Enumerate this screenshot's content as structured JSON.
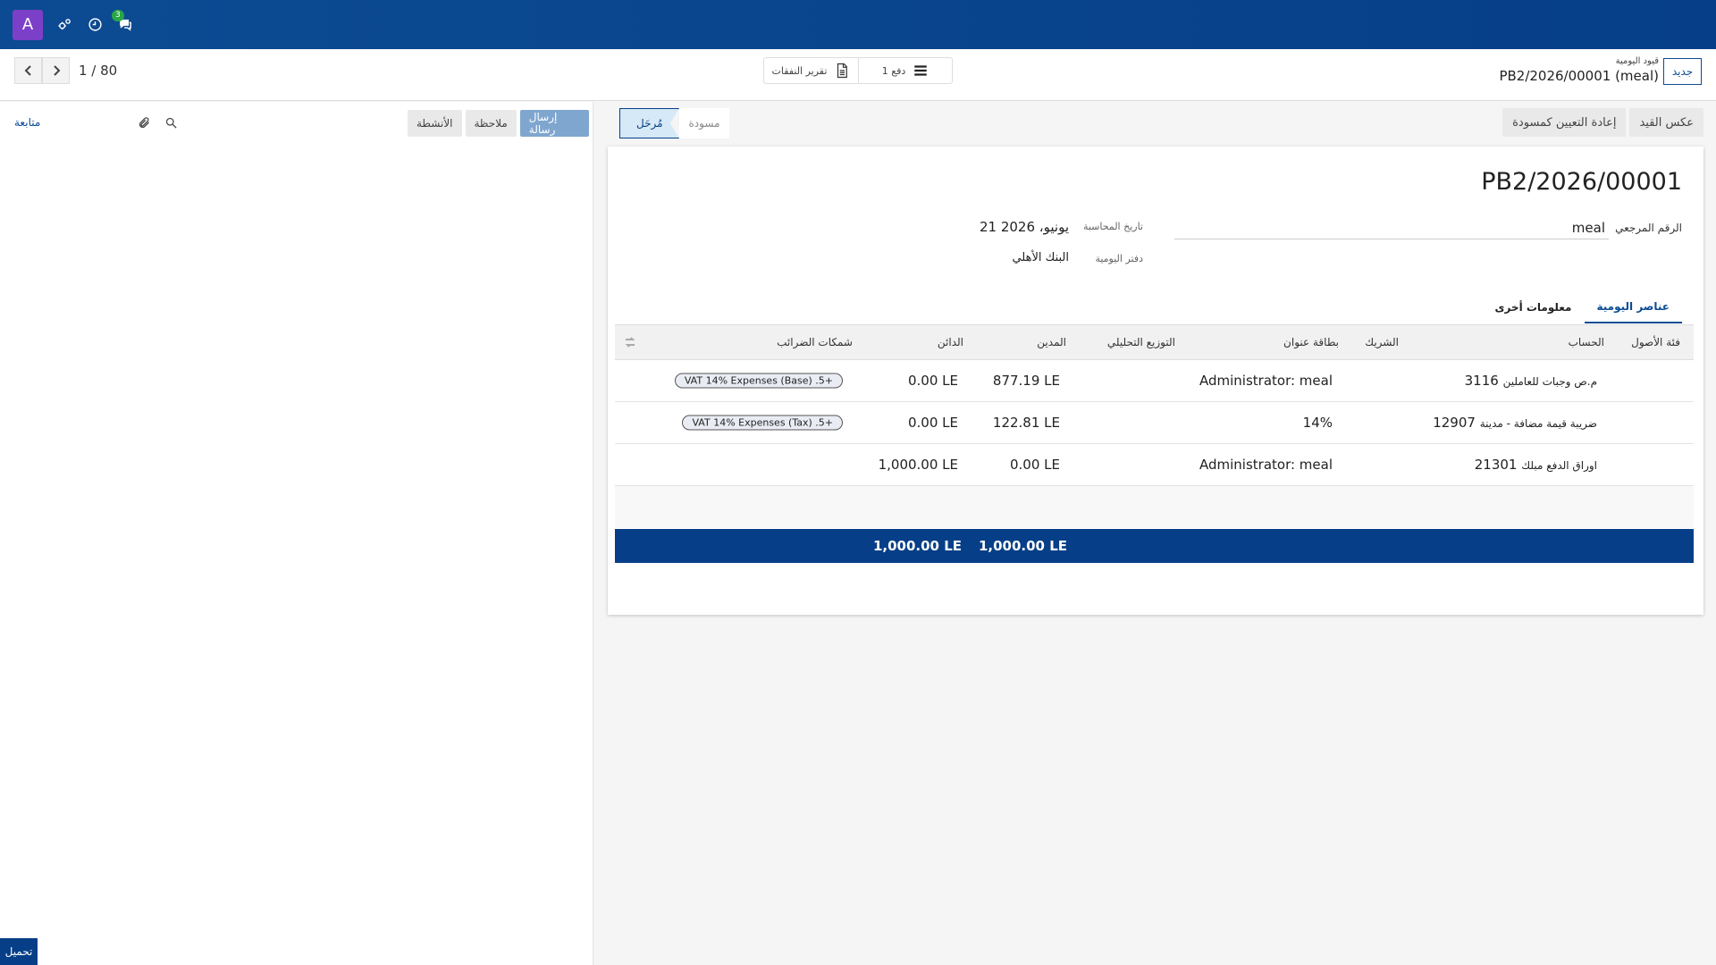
{
  "navbar": {
    "avatar_letter": "A",
    "messages_badge": "3"
  },
  "pager": {
    "value": "1 / 80"
  },
  "center_box": {
    "report_label": "تقرير النفقات",
    "payment_label": "دفع 1"
  },
  "breadcrumb": {
    "parent": "قيود اليومية",
    "title": "PB2/2026/00001 (meal)",
    "new_label": "جديد"
  },
  "chatter": {
    "follow_label": "متابعة",
    "send_message": "إرسال رسالة",
    "log_note": "ملاحظة",
    "activities": "الأنشطة",
    "upload": "تحميل"
  },
  "status": {
    "posted": "مُرحَل",
    "draft": "مسودة"
  },
  "actions": {
    "reset_draft": "إعادة التعيين كمسودة",
    "reverse": "عكس القيد"
  },
  "form": {
    "title": "PB2/2026/00001",
    "ref_label": "الرقم المرجعي",
    "ref_value": "meal",
    "date_label": "تاريخ المحاسبة",
    "date_value": "21 يونيو، 2026",
    "journal_label": "دفتر اليومية",
    "journal_value": "البنك الأهلي"
  },
  "tabs": [
    {
      "label": "عناصر اليومية",
      "active": true
    },
    {
      "label": "معلومات أخرى",
      "active": false
    }
  ],
  "table": {
    "headers": {
      "asset_category": "فئة الأصول",
      "account": "الحساب",
      "partner": "الشريك",
      "label": "بطاقة عنوان",
      "analytic": "التوزيع التحليلي",
      "debit": "المدين",
      "credit": "الدائن",
      "taxes": "شمكات الضرائب"
    },
    "rows": [
      {
        "account_code": "3116",
        "account_name": "م.ص وجبات للعاملين",
        "label": "Administrator: meal",
        "debit": "877.19 LE",
        "credit": "0.00 LE",
        "tax": "VAT 14% Expenses (Base) .5+"
      },
      {
        "account_code": "12907",
        "account_name": "ضريبة قيمة مضافة - مدينة",
        "label": "14%",
        "debit": "122.81 LE",
        "credit": "0.00 LE",
        "tax": "VAT 14% Expenses (Tax) .5+"
      },
      {
        "account_code": "21301",
        "account_name": "اوراق الدفع مبلك",
        "label": "Administrator: meal",
        "debit": "0.00 LE",
        "credit": "1,000.00 LE",
        "tax": ""
      }
    ],
    "totals": {
      "debit": "1,000.00 LE",
      "credit": "1,000.00 LE"
    }
  }
}
